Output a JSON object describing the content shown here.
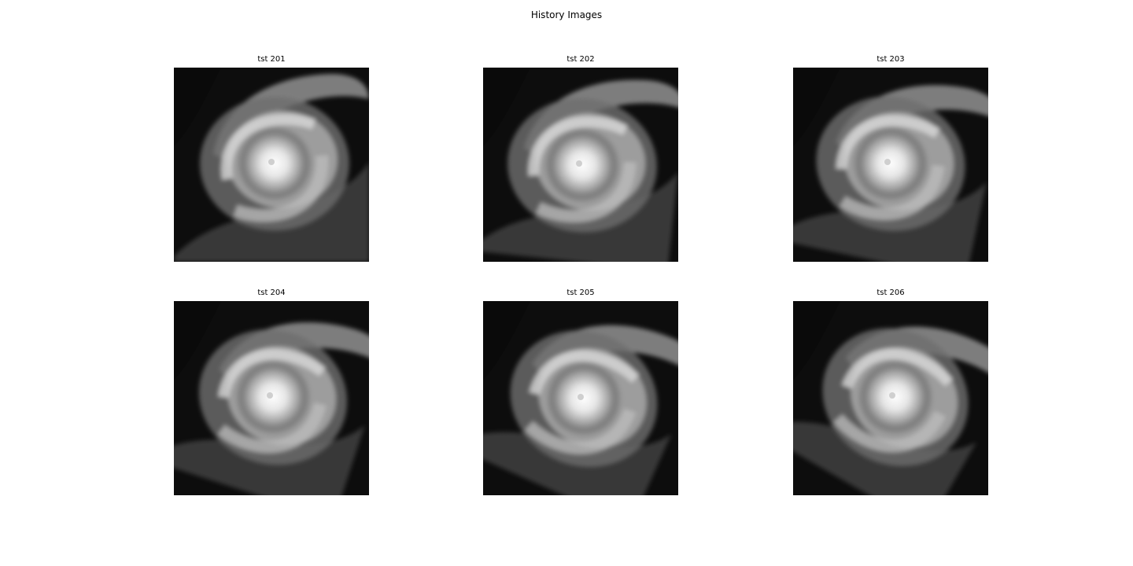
{
  "figure": {
    "title": "History Images"
  },
  "panels": [
    {
      "label": "tst 201",
      "image": "typhoon satellite infrared grayscale image"
    },
    {
      "label": "tst 202",
      "image": "typhoon satellite infrared grayscale image"
    },
    {
      "label": "tst 203",
      "image": "typhoon satellite infrared grayscale image"
    },
    {
      "label": "tst 204",
      "image": "typhoon satellite infrared grayscale image"
    },
    {
      "label": "tst 205",
      "image": "typhoon satellite infrared grayscale image"
    },
    {
      "label": "tst 206",
      "image": "typhoon satellite infrared grayscale image"
    }
  ]
}
